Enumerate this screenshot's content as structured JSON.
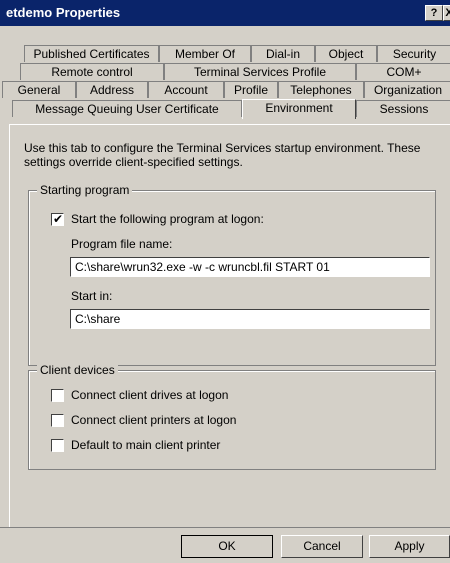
{
  "window": {
    "title": "etdemo Properties",
    "help_glyph": "?",
    "close_glyph": "X"
  },
  "tabs": {
    "row1": [
      "Published Certificates",
      "Member Of",
      "Dial-in",
      "Object",
      "Security"
    ],
    "row2": [
      "Remote control",
      "Terminal Services Profile",
      "COM+"
    ],
    "row3": [
      "General",
      "Address",
      "Account",
      "Profile",
      "Telephones",
      "Organization"
    ],
    "row4": [
      "Message Queuing User Certificate",
      "Environment",
      "Sessions"
    ],
    "active": "Environment"
  },
  "page": {
    "intro": "Use this tab to configure the Terminal Services startup environment. These settings override client-specified settings.",
    "starting_program": {
      "group_label": "Starting program",
      "checkbox_label": "Start the following program at logon:",
      "checked": true,
      "program_label": "Program file name:",
      "program_value": "C:\\share\\wrun32.exe -w -c wruncbl.fil START 01",
      "startin_label": "Start in:",
      "startin_value": "C:\\share"
    },
    "client_devices": {
      "group_label": "Client devices",
      "items": [
        {
          "label": "Connect client drives at logon",
          "checked": false
        },
        {
          "label": "Connect client printers at logon",
          "checked": false
        },
        {
          "label": "Default to main client printer",
          "checked": false
        }
      ]
    }
  },
  "buttons": {
    "ok": "OK",
    "cancel": "Cancel",
    "apply": "Apply"
  }
}
